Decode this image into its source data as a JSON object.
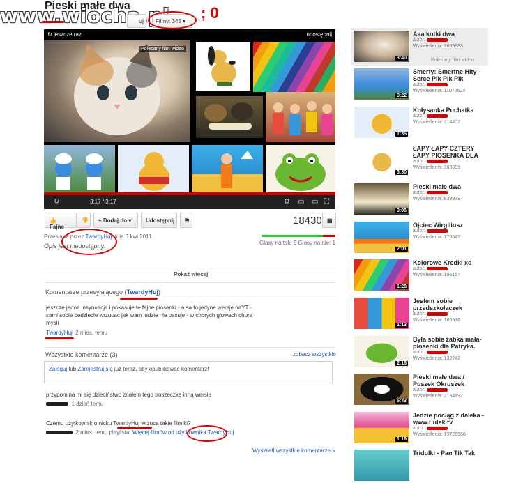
{
  "watermark": "www.wiocha.pl",
  "page_title": "Pieski małe dwa",
  "subscribe_label": "uj",
  "films_label": "Filmy: 345",
  "annotation_text": "; 0",
  "player": {
    "replay_label": "jeszcze raz",
    "share_label": "udostępnij",
    "featured_label": "Polecany film wideo",
    "time_display": "3:17 / 3:17"
  },
  "actions": {
    "like": "Fajne",
    "add": "+ Dodaj do",
    "share": "Udostępnij",
    "views": "18430"
  },
  "uploader": {
    "prefix": "Przesłane przez",
    "name": "TwardyHuj",
    "date_prefix": "dnia",
    "date": "5 kwi 2011",
    "description": "Opis jest niedostępny."
  },
  "ratings_text": "Głosy na tak: 5 Głosy na nie: 1",
  "show_more": "Pokaż więcej",
  "uploader_comments": {
    "heading_prefix": "Komentarze przesyłającego (",
    "heading_name": "TwardyHuj",
    "heading_suffix": ")",
    "text": "jeszcze jedna insynuacja i pokasuje te fajne piosenki - a sa to jedyne wersje naYT - sami sobie bedziecie wrzucac jak wam ludzie nie pasuje - w chorych glowach chore mysli",
    "author": "TwardyHuj",
    "time": "2 mies. temu"
  },
  "all_comments": {
    "heading": "Wszystkie komentarze (3)",
    "see_all": "zobacz wszystkie",
    "login": "Zaloguj",
    "or": "lub",
    "register": "Zarejestruj się",
    "rest": "już teraz, aby opublikować komentarz!",
    "items": [
      {
        "text": "przypomina mi się dzieciństwo znałem tego troszeczkę inną wersie",
        "time": "1 dzień temu"
      },
      {
        "text": "Czemu użytkownik o nicku TwardyHuj wrzuca takie filmiki?",
        "time": "2 mies. temu playlista:",
        "extra": "Więcej filmów od użytkownika TwardyHuj"
      }
    ],
    "show_all": "Wyświetl wszystkie komentarze »"
  },
  "sidebar": {
    "featured": "Polecany film wideo",
    "author_label": "autor:",
    "views_label": "Wyświetlenia:",
    "items": [
      {
        "title": "Aaa kotki dwa",
        "views": "3669983",
        "duration": "3:40",
        "thumb": "kitten"
      },
      {
        "title": "Smerfy: Smerfne Hity - Serce Pik Pik Pik",
        "views": "11078624",
        "duration": "3:22",
        "thumb": "smurf"
      },
      {
        "title": "Kołysanka Puchatka",
        "views": "714402",
        "duration": "1:35",
        "thumb": "pooh"
      },
      {
        "title": "ŁAPY ŁAPY CZTERY ŁAPY PIOSENKA DLA",
        "views": "369809",
        "duration": "3:30",
        "thumb": "pluto"
      },
      {
        "title": "Pieski małe dwa",
        "views": "933979",
        "duration": "3:06",
        "thumb": "dogs"
      },
      {
        "title": "Ojciec Wirgiliusz",
        "views": "773642",
        "duration": "2:01",
        "thumb": "girl"
      },
      {
        "title": "Kolorowe Kredki xd",
        "views": "196157",
        "duration": "1:28",
        "thumb": "crayons"
      },
      {
        "title": "Jestem sobie przedszkolaczek",
        "views": "106576",
        "duration": "1:13",
        "thumb": "kids"
      },
      {
        "title": "Była sobie żabka mała-piosenki dla Patryka.",
        "views": "132242",
        "duration": "2:16",
        "thumb": "frog"
      },
      {
        "title": "Pieski małe dwa / Puszek Okruszek",
        "views": "2184892",
        "duration": "5:43",
        "thumb": "puppy"
      },
      {
        "title": "Jedzie pociąg z daleka - www.Lulek.tv",
        "views": "13726566",
        "duration": "1:16",
        "thumb": "train"
      },
      {
        "title": "Tridulki - Pan Tik Tak",
        "views": "",
        "duration": "",
        "thumb": "tik"
      }
    ]
  }
}
